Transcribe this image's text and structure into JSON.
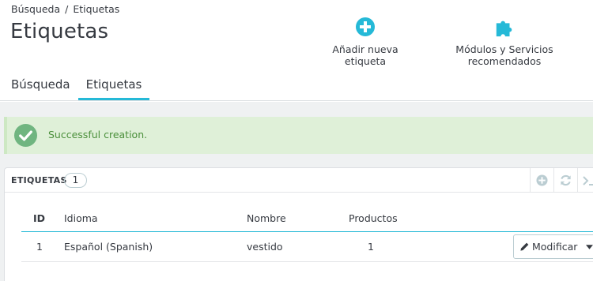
{
  "breadcrumb": {
    "parent": "Búsqueda",
    "separator": "/",
    "current": "Etiquetas"
  },
  "page": {
    "title": "Etiquetas"
  },
  "toolbar": {
    "add_label": "Añadir nueva etiqueta",
    "modules_label": "Módulos y Servicios recomendados"
  },
  "tabs": [
    {
      "label": "Búsqueda",
      "active": false
    },
    {
      "label": "Etiquetas",
      "active": true
    }
  ],
  "alert": {
    "text": "Successful creation."
  },
  "panel": {
    "title": "ETIQUETAS",
    "count": "1",
    "columns": {
      "id": "ID",
      "language": "Idioma",
      "name": "Nombre",
      "products": "Productos"
    },
    "rows": [
      {
        "id": "1",
        "language": "Español (Spanish)",
        "name": "vestido",
        "products": "1",
        "action": "Modificar"
      }
    ]
  },
  "icons": {
    "add": "plus-circle-icon",
    "modules": "puzzle-icon",
    "success": "check-circle-icon",
    "panel_add": "plus-circle-icon",
    "refresh": "refresh-icon",
    "sql": "terminal-icon",
    "edit": "pencil-icon",
    "caret": "caret-down-icon"
  },
  "colors": {
    "accent": "#25b9d7",
    "success_bg": "#dff0d8",
    "success_text": "#4a8f3a",
    "success_icon": "#70b580",
    "text": "#363a41",
    "body_bg": "#eff1f2"
  }
}
